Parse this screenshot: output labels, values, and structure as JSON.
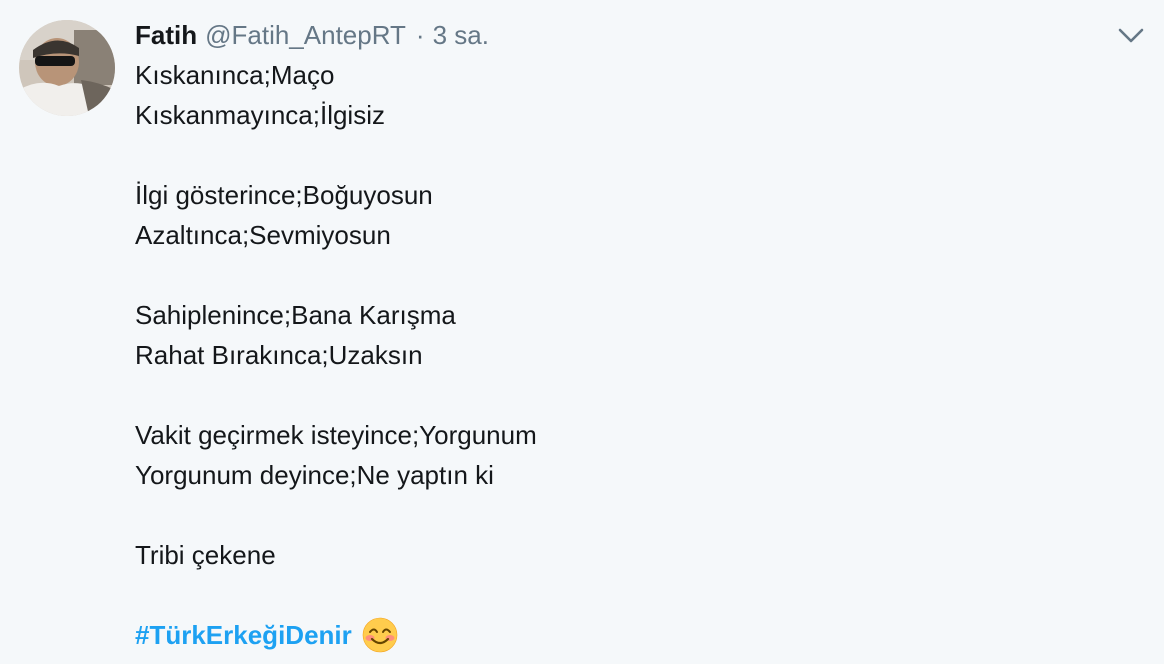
{
  "tweet": {
    "author_name": "Fatih",
    "author_handle": "@Fatih_AntepRT",
    "separator": "·",
    "timestamp": "3 sa.",
    "lines": [
      "Kıskanınca;Maço",
      "Kıskanmayınca;İlgisiz",
      "İlgi gösterince;Boğuyosun",
      "Azaltınca;Sevmiyosun",
      "Sahiplenince;Bana Karışma",
      "Rahat Bırakınca;Uzaksın",
      "Vakit geçirmek isteyince;Yorgunum",
      "Yorgunum deyince;Ne yaptın ki",
      "Tribi çekene"
    ],
    "hashtag": "#TürkErkeğiDenir",
    "emoji_icon": "smiling-face-with-smiling-eyes-icon",
    "menu_icon": "chevron-down-icon",
    "avatar_icon": "avatar"
  },
  "colors": {
    "background": "#f5f8fa",
    "text": "#14171a",
    "muted": "#657786",
    "link": "#1da1f2"
  }
}
